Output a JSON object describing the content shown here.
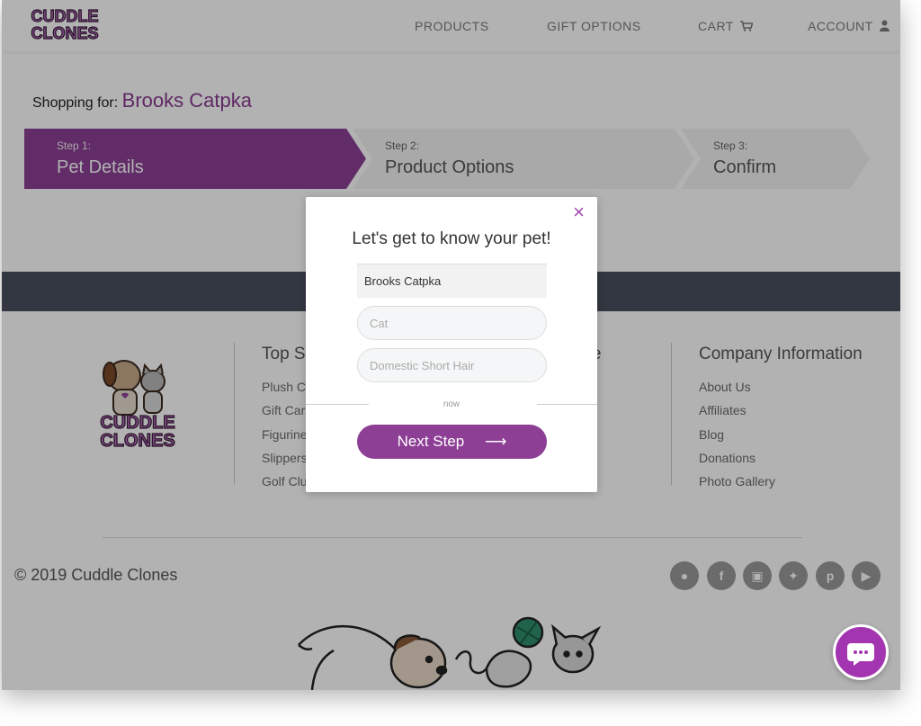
{
  "brand": {
    "logo_line1": "CUDDLE",
    "logo_line2": "CLONES",
    "footer_logo_line1": "CUDDLE",
    "footer_logo_line2": "CLONES"
  },
  "nav": {
    "products": "PRODUCTS",
    "gift_options": "GIFT OPTIONS",
    "cart": "CART",
    "account": "ACCOUNT"
  },
  "shopping": {
    "label": "Shopping for:",
    "pet_name": "Brooks Catpka"
  },
  "steps": [
    {
      "num": "Step 1:",
      "label": "Pet Details"
    },
    {
      "num": "Step 2:",
      "label": "Product Options"
    },
    {
      "num": "Step 3:",
      "label": "Confirm"
    }
  ],
  "footer": {
    "col2_title": "Top Se",
    "col2_links": [
      "Plush C",
      "Gift Car",
      "Figurine",
      "Slippers",
      "Golf Clu"
    ],
    "col3_title_frag": "e",
    "company_title": "Company Information",
    "company_links": [
      "About Us",
      "Affiliates",
      "Blog",
      "Donations",
      "Photo Gallery"
    ],
    "copyright": "© 2019 Cuddle Clones"
  },
  "modal": {
    "close_glyph": "×",
    "title": "Let's get to know your pet!",
    "name_value": "Brooks Catpka",
    "type_placeholder": "Cat",
    "breed_placeholder": "Domestic Short Hair",
    "now_text": "now",
    "next_label": "Next Step",
    "next_arrow": "⟶"
  },
  "colors": {
    "brand_purple": "#8c3f94",
    "dark_band": "#4a4f5e",
    "chat_purple": "#a335b0"
  },
  "icons": [
    "cart-icon",
    "user-icon",
    "close-icon",
    "arrow-right-icon",
    "snapchat-icon",
    "facebook-icon",
    "instagram-icon",
    "twitter-icon",
    "pinterest-icon",
    "youtube-icon",
    "chat-icon"
  ]
}
